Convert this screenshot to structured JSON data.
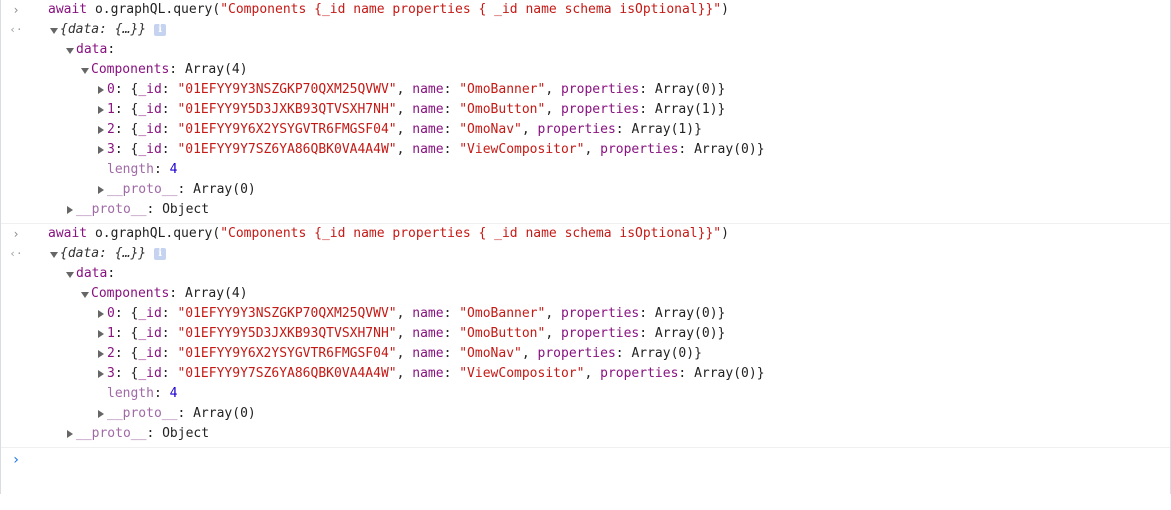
{
  "console": {
    "entries": [
      {
        "input": {
          "prompt_icon": "›",
          "await": "await",
          "call": " o.graphQL.query(",
          "query_string": "\"Components {_id name properties { _id name schema isOptional}}\"",
          "close": ")"
        },
        "result": {
          "return_icon": "‹·",
          "preview": "{data: {…}}",
          "info": "i",
          "data_key": "data",
          "components_key": "Components",
          "components_type": "Array(4)",
          "rows": [
            {
              "index": "0",
              "id": "\"01EFYY9Y3NSZGKP70QXM25QVWV\"",
              "name": "\"OmoBanner\"",
              "properties": "Array(0)"
            },
            {
              "index": "1",
              "id": "\"01EFYY9Y5D3JXKB93QTVSXH7NH\"",
              "name": "\"OmoButton\"",
              "properties": "Array(1)"
            },
            {
              "index": "2",
              "id": "\"01EFYY9Y6X2YSYGVTR6FMGSF04\"",
              "name": "\"OmoNav\"",
              "properties": "Array(1)"
            },
            {
              "index": "3",
              "id": "\"01EFYY9Y7SZ6YA86QBK0VA4A4W\"",
              "name": "\"ViewCompositor\"",
              "properties": "Array(0)"
            }
          ],
          "length_key": "length",
          "length_value": "4",
          "array_proto_key": "__proto__",
          "array_proto_value": "Array(0)",
          "object_proto_key": "__proto__",
          "object_proto_value": "Object"
        }
      },
      {
        "input": {
          "prompt_icon": "›",
          "await": "await",
          "call": " o.graphQL.query(",
          "query_string": "\"Components {_id name properties { _id name schema isOptional}}\"",
          "close": ")"
        },
        "result": {
          "return_icon": "‹·",
          "preview": "{data: {…}}",
          "info": "i",
          "data_key": "data",
          "components_key": "Components",
          "components_type": "Array(4)",
          "rows": [
            {
              "index": "0",
              "id": "\"01EFYY9Y3NSZGKP70QXM25QVWV\"",
              "name": "\"OmoBanner\"",
              "properties": "Array(0)"
            },
            {
              "index": "1",
              "id": "\"01EFYY9Y5D3JXKB93QTVSXH7NH\"",
              "name": "\"OmoButton\"",
              "properties": "Array(0)"
            },
            {
              "index": "2",
              "id": "\"01EFYY9Y6X2YSYGVTR6FMGSF04\"",
              "name": "\"OmoNav\"",
              "properties": "Array(0)"
            },
            {
              "index": "3",
              "id": "\"01EFYY9Y7SZ6YA86QBK0VA4A4W\"",
              "name": "\"ViewCompositor\"",
              "properties": "Array(0)"
            }
          ],
          "length_key": "length",
          "length_value": "4",
          "array_proto_key": "__proto__",
          "array_proto_value": "Array(0)",
          "object_proto_key": "__proto__",
          "object_proto_value": "Object"
        }
      }
    ],
    "prompt_icon": "›",
    "labels": {
      "id_key": "_id",
      "name_key": "name",
      "properties_key": "properties",
      "open_brace": "{",
      "close_brace": "}",
      "colon": ": ",
      "comma": ", "
    }
  },
  "colors": {
    "keyword": "#881280",
    "string": "#c41a16",
    "number": "#1c00cf",
    "prompt_accent": "#1a73e8"
  }
}
